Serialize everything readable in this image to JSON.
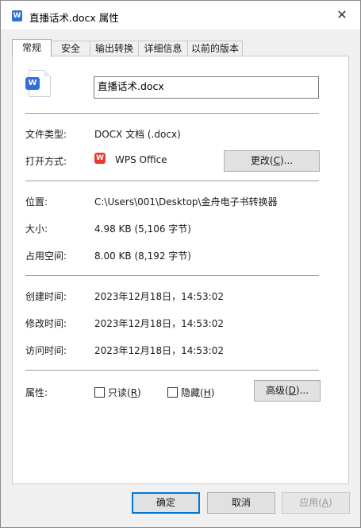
{
  "window": {
    "title": "直播话术.docx 属性",
    "icon": "word-doc-icon",
    "close": "✕"
  },
  "tabs": [
    {
      "label": "常规",
      "active": true
    },
    {
      "label": "安全"
    },
    {
      "label": "输出转换"
    },
    {
      "label": "详细信息"
    },
    {
      "label": "以前的版本"
    }
  ],
  "general": {
    "file_name": "直播话术.docx",
    "type_label": "文件类型:",
    "type_value": "DOCX 文档 (.docx)",
    "open_with_label": "打开方式:",
    "open_with_app": "WPS Office",
    "change_button": {
      "label": "更改",
      "key": "C",
      "suffix": "..."
    },
    "location_label": "位置:",
    "location_value": "C:\\Users\\001\\Desktop\\金舟电子书转换器",
    "size_label": "大小:",
    "size_value": "4.98 KB (5,106 字节)",
    "disk_size_label": "占用空间:",
    "disk_size_value": "8.00 KB (8,192 字节)",
    "created_label": "创建时间:",
    "created_value": "2023年12月18日，14:53:02",
    "modified_label": "修改时间:",
    "modified_value": "2023年12月18日，14:53:02",
    "accessed_label": "访问时间:",
    "accessed_value": "2023年12月18日，14:53:02",
    "attributes_label": "属性:",
    "readonly": {
      "label": "只读",
      "key": "R",
      "checked": false
    },
    "hidden": {
      "label": "隐藏",
      "key": "H",
      "checked": false
    },
    "advanced_button": {
      "label": "高级",
      "key": "D",
      "suffix": "..."
    }
  },
  "footer": {
    "ok": "确定",
    "cancel": "取消",
    "apply": {
      "label": "应用",
      "key": "A"
    }
  },
  "colors": {
    "accent": "#0078d7",
    "word_blue": "#2f6fd8",
    "wps_red": "#e63b2e"
  }
}
